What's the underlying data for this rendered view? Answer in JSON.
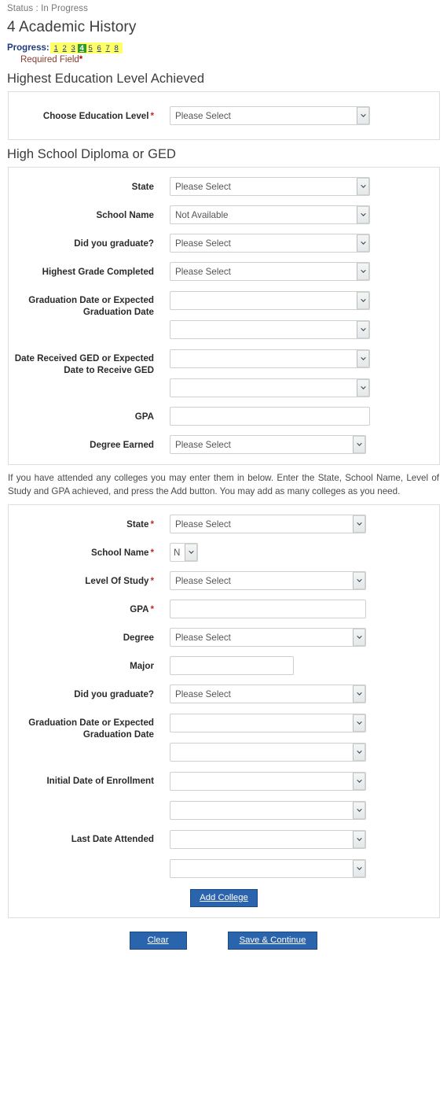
{
  "header": {
    "status": "Status : In Progress",
    "page_title": "4 Academic History",
    "progress_label": "Progress:",
    "progress_steps": [
      "1",
      "2",
      "3",
      "4",
      "5",
      "6",
      "7",
      "8"
    ],
    "current_step": "4",
    "required_note": "Required Field",
    "required_star": "*",
    "accent_highlight": "#ffff66",
    "accent_current": "#2e9b2e",
    "accent_button": "#2a64ad",
    "accent_required": "#b03030"
  },
  "sections": {
    "education_level": {
      "heading": "Highest Education Level Achieved",
      "fields": [
        {
          "label": "Choose Education Level",
          "required": true,
          "type": "select",
          "value": "Please Select",
          "size": "wide"
        }
      ]
    },
    "high_school": {
      "heading": "High School Diploma or GED",
      "fields": [
        {
          "label": "State",
          "required": false,
          "type": "select",
          "value": "Please Select",
          "size": "wide"
        },
        {
          "label": "School Name",
          "required": false,
          "type": "select",
          "value": "Not Available",
          "size": "wide"
        },
        {
          "label": "Did you graduate?",
          "required": false,
          "type": "select",
          "value": "Please Select",
          "size": "wide"
        },
        {
          "label": "Highest Grade Completed",
          "required": false,
          "type": "select",
          "value": "Please Select",
          "size": "wide"
        },
        {
          "label": "Graduation Date or Expected Graduation Date",
          "required": false,
          "type": "select-pair",
          "value": "",
          "value2": "",
          "size": "wide"
        },
        {
          "label": "Date Received GED or Expected Date to Receive GED",
          "required": false,
          "type": "select-pair",
          "value": "",
          "value2": "",
          "size": "wide"
        },
        {
          "label": "GPA",
          "required": false,
          "type": "text",
          "value": "",
          "size": "wide"
        },
        {
          "label": "Degree Earned",
          "required": false,
          "type": "select",
          "value": "Please Select",
          "size": "wide"
        }
      ]
    },
    "college": {
      "help_text": "If you have attended any colleges you may enter them in below. Enter the State, School Name, Level of Study and GPA achieved, and press the Add button. You may add as many colleges as you need.",
      "fields": [
        {
          "label": "State",
          "required": true,
          "type": "select",
          "value": "Please Select",
          "size": "wide"
        },
        {
          "label": "School Name",
          "required": true,
          "type": "select",
          "value": "N",
          "size": "narrow"
        },
        {
          "label": "Level Of Study",
          "required": true,
          "type": "select",
          "value": "Please Select",
          "size": "wide"
        },
        {
          "label": "GPA",
          "required": true,
          "type": "text",
          "value": "",
          "size": "wide"
        },
        {
          "label": "Degree",
          "required": false,
          "type": "select",
          "value": "Please Select",
          "size": "wide"
        },
        {
          "label": "Major",
          "required": false,
          "type": "text",
          "value": "",
          "size": "major"
        },
        {
          "label": "Did you graduate?",
          "required": false,
          "type": "select",
          "value": "Please Select",
          "size": "wide"
        },
        {
          "label": "Graduation Date or Expected Graduation Date",
          "required": false,
          "type": "select-pair",
          "value": "",
          "value2": "",
          "size": "wide"
        },
        {
          "label": "Initial Date of Enrollment",
          "required": false,
          "type": "select-pair",
          "value": "",
          "value2": "",
          "size": "wide"
        },
        {
          "label": "Last Date Attended",
          "required": false,
          "type": "select-pair",
          "value": "",
          "value2": "",
          "size": "wide"
        }
      ],
      "add_button": "Add College"
    }
  },
  "footer": {
    "clear_button": "Clear",
    "save_button": "Save & Continue"
  }
}
